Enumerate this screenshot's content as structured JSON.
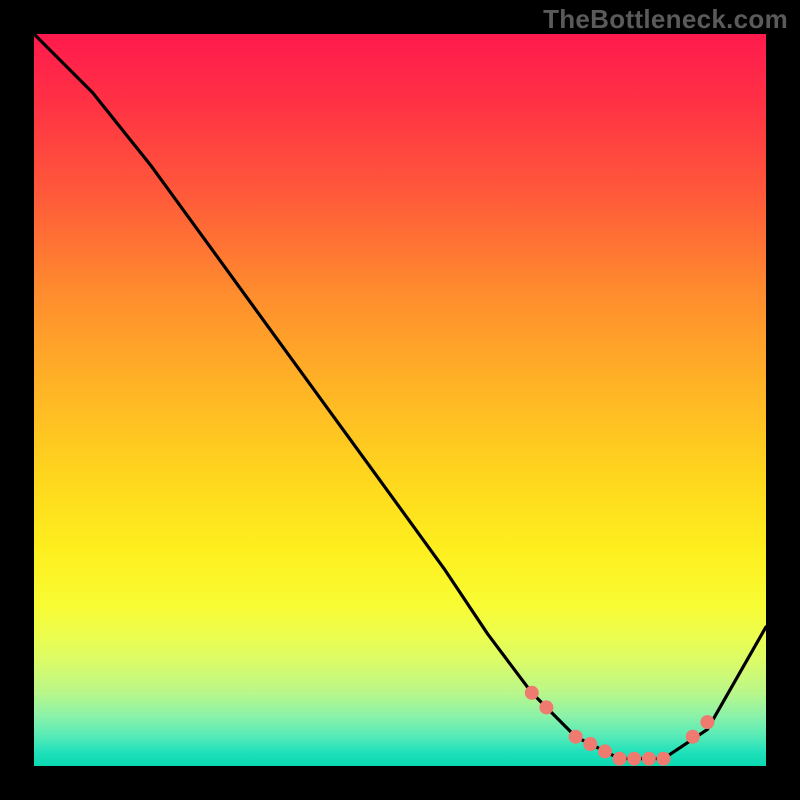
{
  "watermark": "TheBottleneck.com",
  "chart_data": {
    "type": "line",
    "title": "",
    "xlabel": "",
    "ylabel": "",
    "xlim": [
      0,
      100
    ],
    "ylim": [
      0,
      100
    ],
    "background_gradient": {
      "top_color": "#ff1a4d",
      "mid_color": "#ffd51e",
      "bottom_color": "#07d9b1"
    },
    "series": [
      {
        "name": "bottleneck-curve",
        "color": "#000000",
        "x": [
          0,
          8,
          16,
          24,
          32,
          40,
          48,
          56,
          62,
          68,
          74,
          80,
          86,
          92,
          100
        ],
        "y": [
          100,
          92,
          82,
          71,
          60,
          49,
          38,
          27,
          18,
          10,
          4,
          1,
          1,
          5,
          19
        ]
      }
    ],
    "markers": {
      "name": "highlighted-range",
      "color": "#ef7a70",
      "x": [
        68,
        70,
        74,
        76,
        78,
        80,
        82,
        84,
        86,
        90,
        92
      ],
      "y": [
        10,
        8,
        4,
        3,
        2,
        1,
        1,
        1,
        1,
        4,
        6
      ]
    }
  }
}
